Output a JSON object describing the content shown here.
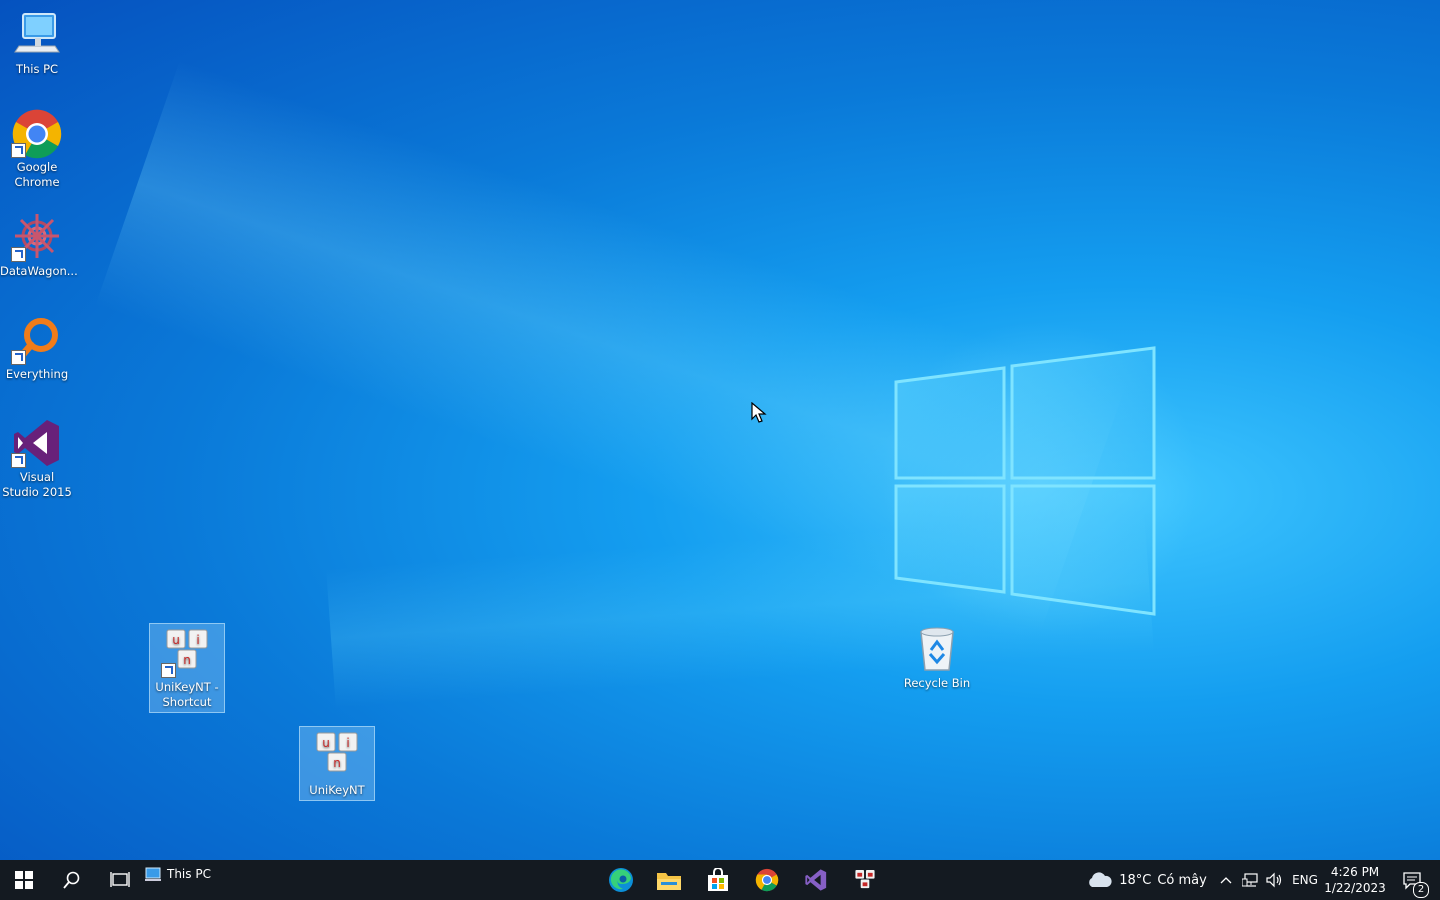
{
  "desktop": {
    "icons": [
      {
        "label": "This PC"
      },
      {
        "label": "Google Chrome"
      },
      {
        "label": "DataWagon..."
      },
      {
        "label": "Everything"
      },
      {
        "label": "Visual Studio 2015"
      },
      {
        "label": "UniKeyNT - Shortcut"
      },
      {
        "label": "UniKeyNT"
      },
      {
        "label": "Recycle Bin"
      }
    ]
  },
  "taskbar": {
    "pinned_window_label": "This PC",
    "apps": [
      "edge-icon",
      "file-explorer-icon",
      "store-icon",
      "chrome-icon",
      "visual-studio-icon",
      "unikey-icon"
    ],
    "weather": {
      "temp": "18°C",
      "condition": "Có mây"
    },
    "language": "ENG",
    "clock": {
      "time": "4:26 PM",
      "date": "1/22/2023"
    },
    "notifications_count": "2"
  },
  "colors": {
    "taskbar_bg": "#141a21",
    "desktop_accent": "#149ef0"
  }
}
